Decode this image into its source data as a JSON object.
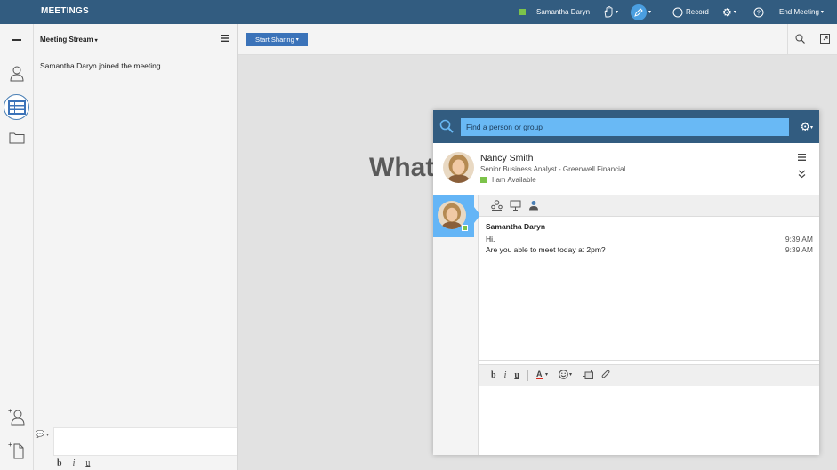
{
  "app": {
    "title": "MEETINGS"
  },
  "topbar": {
    "user_name": "Samantha Daryn",
    "record_label": "Record",
    "end_meeting_label": "End Meeting"
  },
  "stream": {
    "header": "Meeting Stream",
    "messages": [
      "Samantha Daryn joined the meeting"
    ],
    "format_buttons": [
      "b",
      "i",
      "u"
    ]
  },
  "main": {
    "start_sharing_label": "Start Sharing",
    "headline": "What"
  },
  "chat": {
    "search_placeholder": "Find a person or group",
    "contact": {
      "name": "Nancy Smith",
      "title": "Senior Business Analyst - Greenwell Financial",
      "status": "I am Available"
    },
    "transcript": {
      "sender": "Samantha Daryn",
      "messages": [
        {
          "text": "Hi.",
          "time": "9:39 AM"
        },
        {
          "text": "Are you able to meet today at 2pm?",
          "time": "9:39 AM"
        }
      ]
    },
    "format_buttons": [
      "b",
      "i",
      "u"
    ]
  },
  "colors": {
    "topbar": "#325c80",
    "accent": "#3b73b9",
    "search_field": "#69b9f5",
    "available": "#7cc34a"
  }
}
